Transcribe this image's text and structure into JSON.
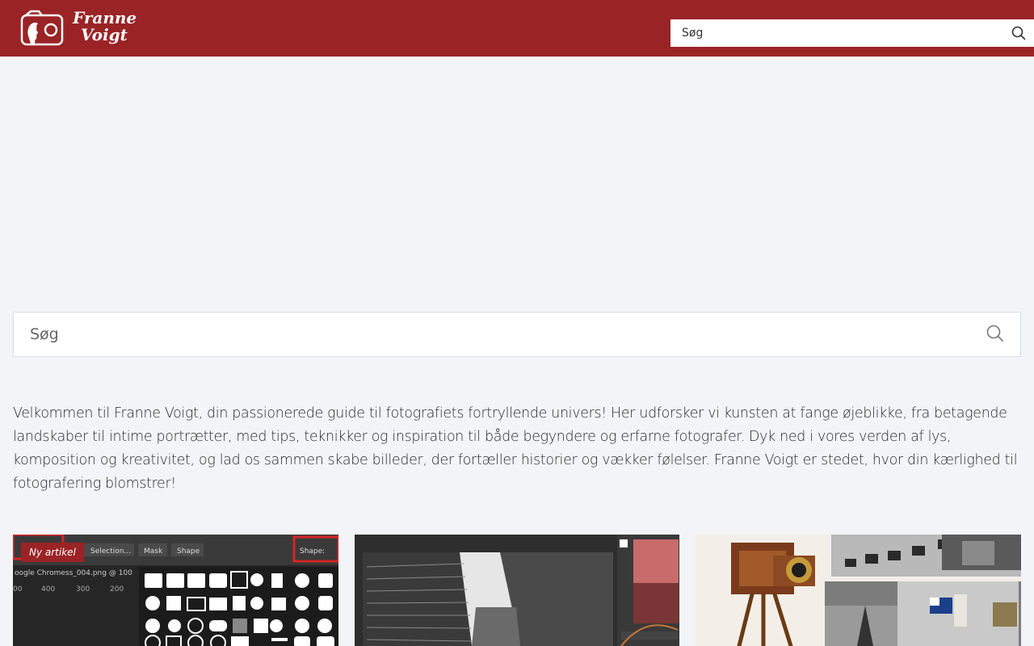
{
  "header": {
    "logo_line1": "Franne",
    "logo_line2": "Voigt",
    "search_placeholder": "Søg"
  },
  "main": {
    "search_placeholder": "Søg",
    "intro": "Velkommen til Franne Voigt, din passionerede guide til fotografiets fortryllende univers! Her udforsker vi kunsten at fange øjeblikke, fra betagende landskaber til intime portrætter, med tips, teknikker og inspiration til både begyndere og erfarne fotografer. Dyk ned i vores verden af lys, komposition og kreativitet, og lad os sammen skabe billeder, der fortæller historier og vækker følelser. Franne Voigt er stedet, hvor din kærlighed til fotografering blomstrer!"
  },
  "cards": {
    "badge": "Ny artikel",
    "card1_screen": {
      "toolbar": [
        "Selection...",
        "Mask",
        "Shape"
      ],
      "shape_label": "Shape:",
      "file_tab": "oogle Chromess_004.png @ 100",
      "ruler": [
        "00",
        "400",
        "300",
        "200"
      ]
    }
  },
  "colors": {
    "brand": "#9a2326",
    "background": "#f2f4f7"
  },
  "icons": {
    "header_logo": "camera-portrait-icon",
    "search": "search-icon"
  }
}
